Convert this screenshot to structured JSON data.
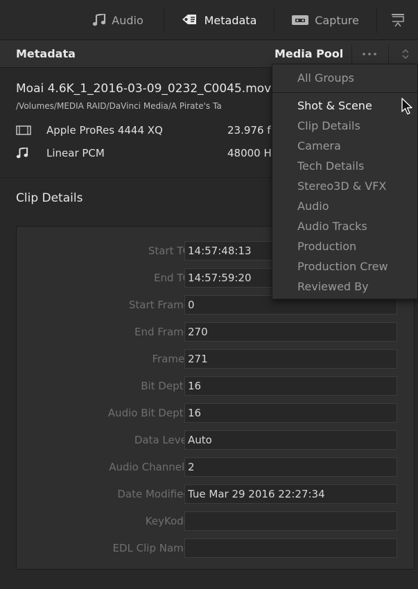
{
  "tabs": [
    {
      "label": "Audio",
      "icon": "music-note-icon"
    },
    {
      "label": "Metadata",
      "icon": "tag-icon",
      "active": true
    },
    {
      "label": "Capture",
      "icon": "tape-icon"
    }
  ],
  "header": {
    "title": "Metadata",
    "pool": "Media Pool"
  },
  "clip": {
    "name": "Moai 4.6K_1_2016-03-09_0232_C0045.mov",
    "path": "/Volumes/MEDIA RAID/DaVinci Media/A Pirate's Ta",
    "video_codec": "Apple ProRes 4444 XQ",
    "frame_rate": "23.976 f",
    "audio_codec": "Linear PCM",
    "sample_rate": "48000 H"
  },
  "section": {
    "title": "Clip Details"
  },
  "fields": [
    {
      "label": "Start TC",
      "value": "14:57:48:13"
    },
    {
      "label": "End TC",
      "value": "14:57:59:20"
    },
    {
      "label": "Start Frame",
      "value": "0"
    },
    {
      "label": "End Frame",
      "value": "270"
    },
    {
      "label": "Frames",
      "value": "271"
    },
    {
      "label": "Bit Depth",
      "value": "16"
    },
    {
      "label": "Audio Bit Depth",
      "value": "16"
    },
    {
      "label": "Data Level",
      "value": "Auto"
    },
    {
      "label": "Audio Channels",
      "value": "2"
    },
    {
      "label": "Date Modified",
      "value": "Tue Mar 29 2016 22:27:34"
    },
    {
      "label": "KeyKode",
      "value": ""
    },
    {
      "label": "EDL Clip Name",
      "value": ""
    }
  ],
  "menu": {
    "header": "All Groups",
    "items": [
      {
        "label": "Shot & Scene",
        "highlighted": true
      },
      {
        "label": "Clip Details"
      },
      {
        "label": "Camera"
      },
      {
        "label": "Tech Details"
      },
      {
        "label": "Stereo3D & VFX"
      },
      {
        "label": "Audio"
      },
      {
        "label": "Audio Tracks"
      },
      {
        "label": "Production"
      },
      {
        "label": "Production Crew"
      },
      {
        "label": "Reviewed By"
      }
    ]
  }
}
